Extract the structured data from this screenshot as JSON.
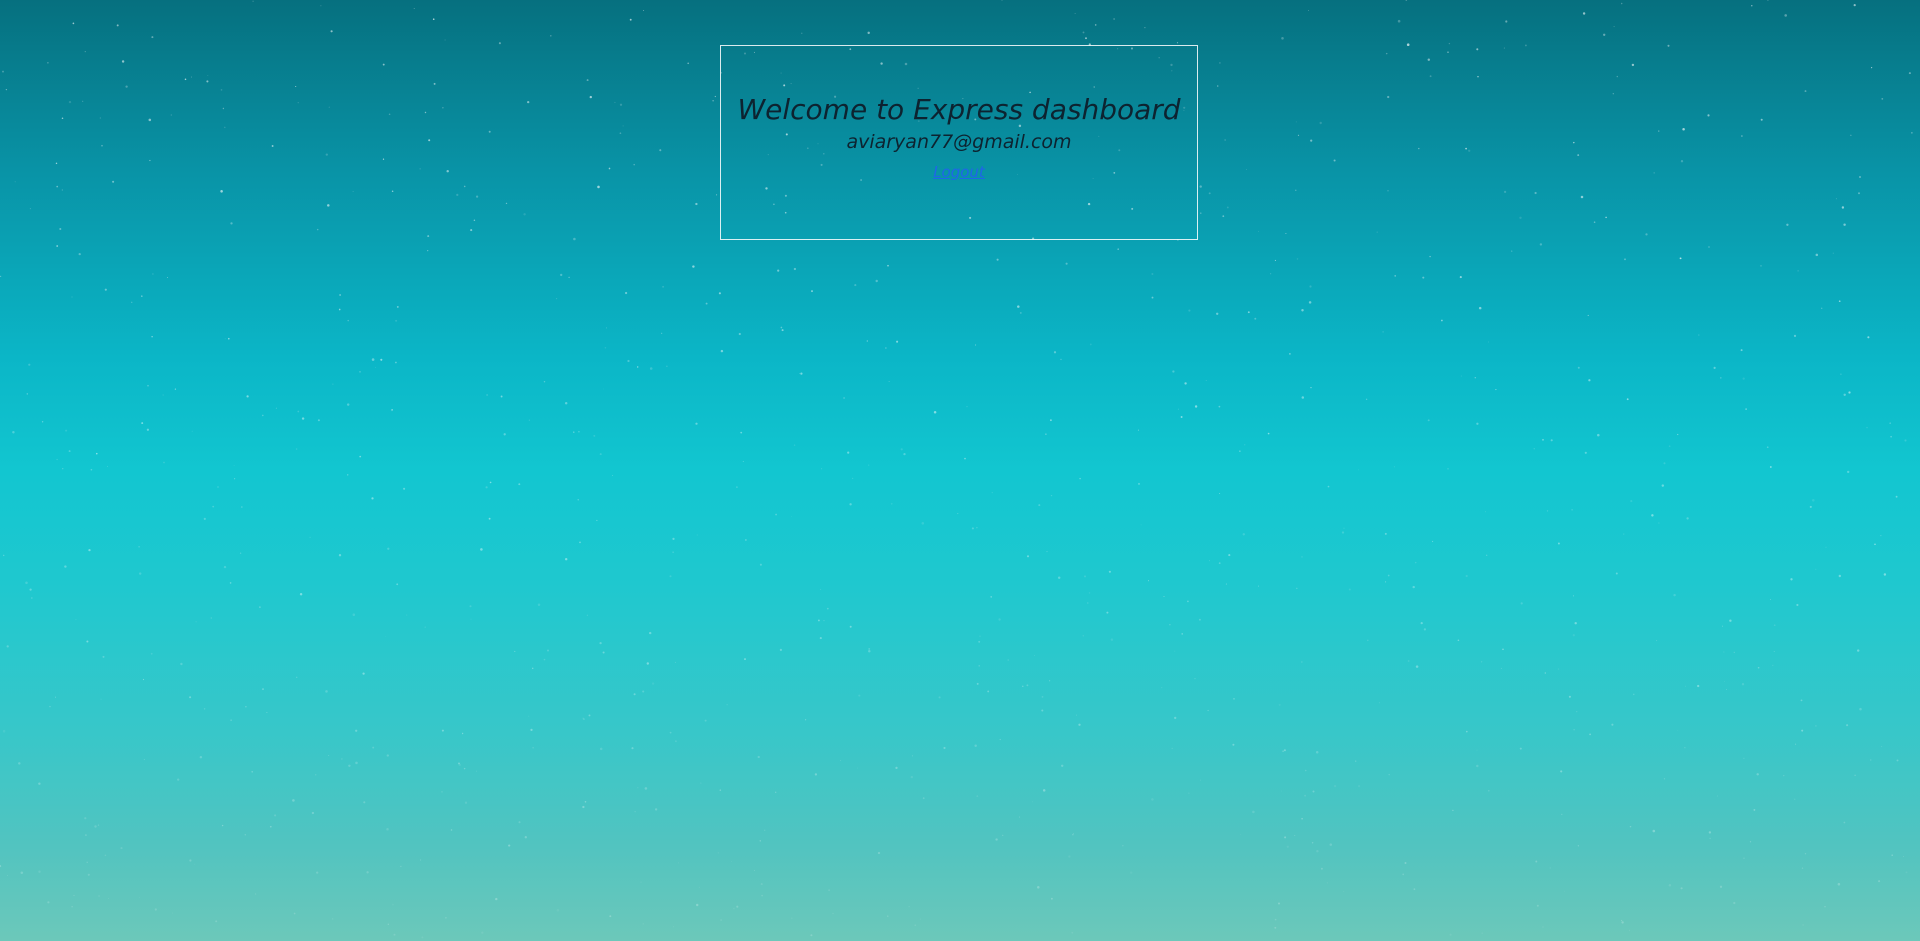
{
  "dashboard": {
    "title": "Welcome to Express dashboard",
    "email": "aviaryan77@gmail.com",
    "logout_label": "Logout"
  },
  "colors": {
    "background_top": "#06707f",
    "background_middle": "#12c6d0",
    "background_bottom": "#6cc8ba",
    "text": "#0d2330",
    "link": "#1f66e8",
    "card_border": "#ffffff"
  }
}
